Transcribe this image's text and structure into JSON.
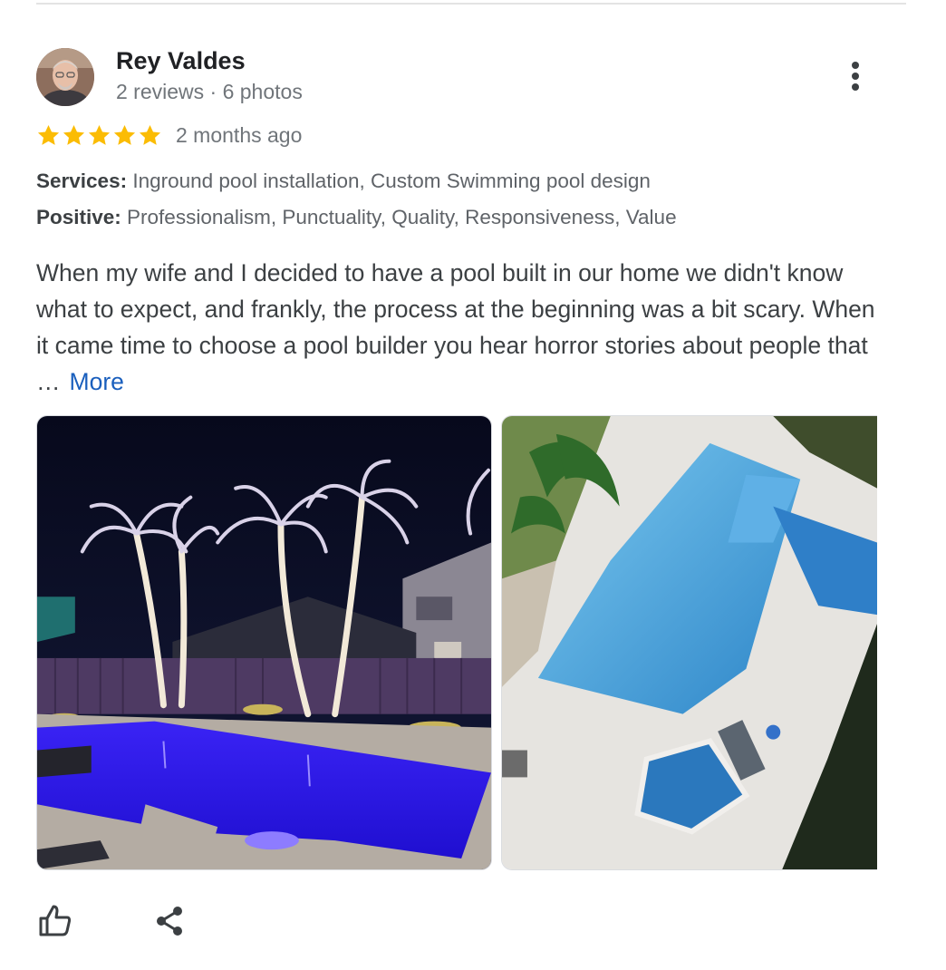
{
  "reviewer": {
    "name": "Rey Valdes",
    "meta": "2 reviews · 6 photos"
  },
  "rating": {
    "stars": 5,
    "max_stars": 5,
    "date": "2 months ago"
  },
  "attributes": {
    "services_label": "Services:",
    "services_value": "Inground pool installation, Custom Swimming pool design",
    "positive_label": "Positive:",
    "positive_value": "Professionalism, Punctuality, Quality, Responsiveness, Value"
  },
  "review": {
    "text": "When my wife and I decided to have a pool built in our home we didn't know what to expect, and frankly, the process at the beginning was a bit scary. When it came time to choose a pool builder you hear horror stories about people that …",
    "more_label": "More"
  },
  "icons": {
    "avatar": "avatar",
    "menu": "more-vert-icon",
    "star": "star-icon",
    "like": "thumbs-up-icon",
    "share": "share-icon"
  },
  "colors": {
    "star": "#fbbc04",
    "link": "#1a5fbd",
    "pool_night": "#2a14ea",
    "pool_day": "#4aa3e0"
  }
}
